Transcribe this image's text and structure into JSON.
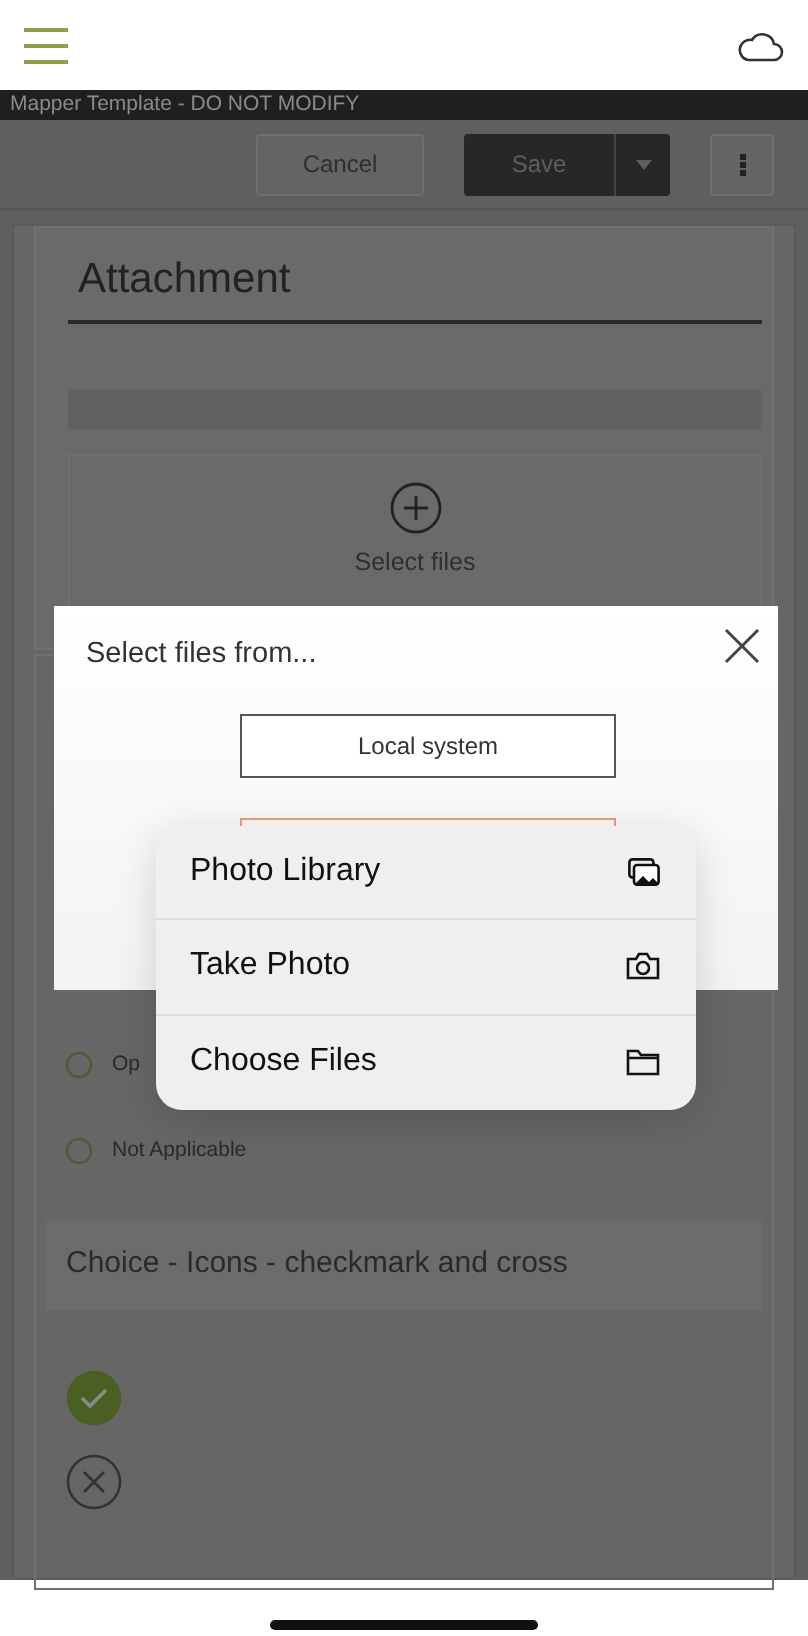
{
  "form_title": "Mapper Template - DO NOT MODIFY",
  "toolbar": {
    "cancel": "Cancel",
    "save": "Save"
  },
  "attachment": {
    "title": "Attachment",
    "dropzone_label": "Select files"
  },
  "radio_options": [
    {
      "label": "Op",
      "selected": false
    },
    {
      "label": "Not Applicable",
      "selected": false
    }
  ],
  "choice_field": {
    "label": "Choice - Icons - checkmark and cross",
    "options": [
      {
        "kind": "check",
        "selected": true
      },
      {
        "kind": "cross",
        "selected": false
      }
    ]
  },
  "dialog": {
    "title": "Select files from...",
    "buttons": [
      "Local system"
    ]
  },
  "action_sheet": {
    "items": [
      {
        "label": "Photo Library",
        "kind": "photos"
      },
      {
        "label": "Take Photo",
        "kind": "camera"
      },
      {
        "label": "Choose Files",
        "kind": "folder"
      }
    ]
  }
}
